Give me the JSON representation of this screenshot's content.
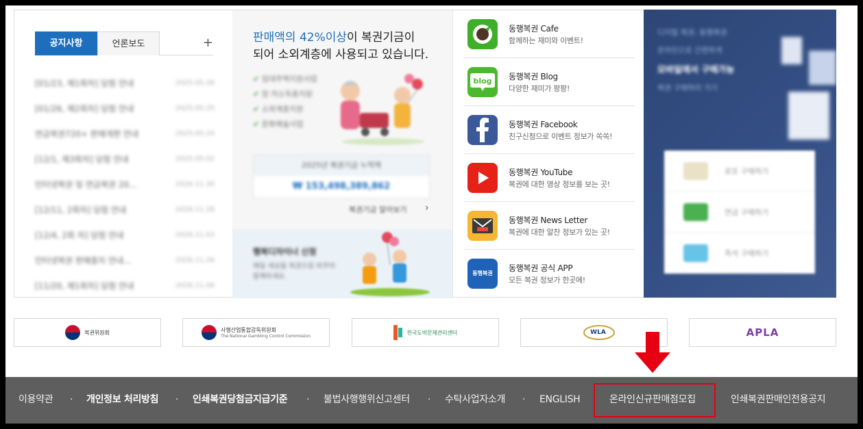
{
  "notice": {
    "tabs": [
      "공지사항",
      "언론보도"
    ],
    "more": "+",
    "items": [
      {
        "title": "[01/23, 제1회차] 당첨 안내",
        "date": "2025.05.26"
      },
      {
        "title": "[01/26, 제2회차] 당첨 안내",
        "date": "2025.05.25"
      },
      {
        "title": "연금복권720+ 판매개편 안내",
        "date": "2025.05.24"
      },
      {
        "title": "[12/1, 제3회차] 당첨 안내",
        "date": "2025.05.02"
      },
      {
        "title": "인터넷복권 및 연금복권 20...",
        "date": "2026.11.30"
      },
      {
        "title": "[12/11, 2회차] 당첨 안내",
        "date": "2026.11.28"
      },
      {
        "title": "[12/4, 2회 차] 당첨 안내",
        "date": "2026.11.03"
      },
      {
        "title": "인터넷복권 판매중지 안내...",
        "date": "2026.11.26"
      },
      {
        "title": "[11/20, 제1회차] 당첨 안내",
        "date": "2026.11.06"
      }
    ]
  },
  "fund": {
    "headline_highlight": "판매액의 42%이상",
    "headline_rest1": "이 복권기금이",
    "headline_rest2": "되어 소외계층에 사용되고 있습니다.",
    "checks": [
      "임대주택지원사업",
      "장·저소득층지원",
      "소외계층지원",
      "문화예술사업"
    ],
    "stat_title": "2025년 복권기금 누적액",
    "stat_value": "₩ 153,498,389,862",
    "link": "복권기금 알아보기",
    "happy_title": "행복디자이너 신청",
    "happy_desc1": "매일 세상을 복권으로 바꾸어",
    "happy_desc2": "함께하세요."
  },
  "social": [
    {
      "title": "동행복권 Cafe",
      "desc": "함께하는 재미와 이벤트!",
      "icon": "cafe-icon",
      "color": "#3fae2a"
    },
    {
      "title": "동행복권 Blog",
      "desc": "다양한 재미가 팡팡!",
      "icon": "blog-icon",
      "color": "#4cb82d"
    },
    {
      "title": "동행복권 Facebook",
      "desc": "친구신청으로 이벤트 정보가 쏙쏙!",
      "icon": "facebook-icon",
      "color": "#3b5998"
    },
    {
      "title": "동행복권 YouTube",
      "desc": "복권에 대한 영상 정보를 보는 곳!",
      "icon": "youtube-icon",
      "color": "#e62117"
    },
    {
      "title": "동행복권 News Letter",
      "desc": "복권에 대한 알찬 정보가 있는 곳!",
      "icon": "newsletter-icon",
      "color": "#f5b731"
    },
    {
      "title": "동행복권 공식 APP",
      "desc": "모든 복권 정보가 한곳에!",
      "icon": "app-icon",
      "color": "#1e63b8"
    }
  ],
  "app_icon_text": "동행복권",
  "banner": {
    "lines": [
      "디지털 복권, 동행복권",
      "온라인으로 간편하게",
      "모바일에서 구매가능",
      "복권 구매하러 가기"
    ],
    "rows": [
      "로또 구매하기",
      "연금 구매하기",
      "즉석 구매하기"
    ]
  },
  "partners": [
    {
      "name": "복권위원회",
      "sub": ""
    },
    {
      "name": "사행산업통합감독위원회",
      "sub": "The National Gambling Control Commission"
    },
    {
      "name": "한국도박문제관리센터",
      "sub": ""
    },
    {
      "name": "WLA",
      "sub": ""
    },
    {
      "name": "APLA",
      "sub": ""
    }
  ],
  "footer": {
    "links": [
      {
        "label": "이용약관",
        "bold": false
      },
      {
        "label": "개인정보 처리방침",
        "bold": true
      },
      {
        "label": "인쇄복권당첨금지급기준",
        "bold": true
      },
      {
        "label": "불법사행행위신고센터",
        "bold": false
      },
      {
        "label": "수탁사업자소개",
        "bold": false
      },
      {
        "label": "ENGLISH",
        "bold": false
      },
      {
        "label": "온라인신규판매점모집",
        "bold": false
      },
      {
        "label": "인쇄복권판매인전용공지",
        "bold": false
      }
    ],
    "separator": "·"
  },
  "colors": {
    "accent": "#1d6fbd",
    "footer_bg": "#5e5e5e",
    "highlight": "#e60012",
    "banner_bg": "#344f84"
  }
}
